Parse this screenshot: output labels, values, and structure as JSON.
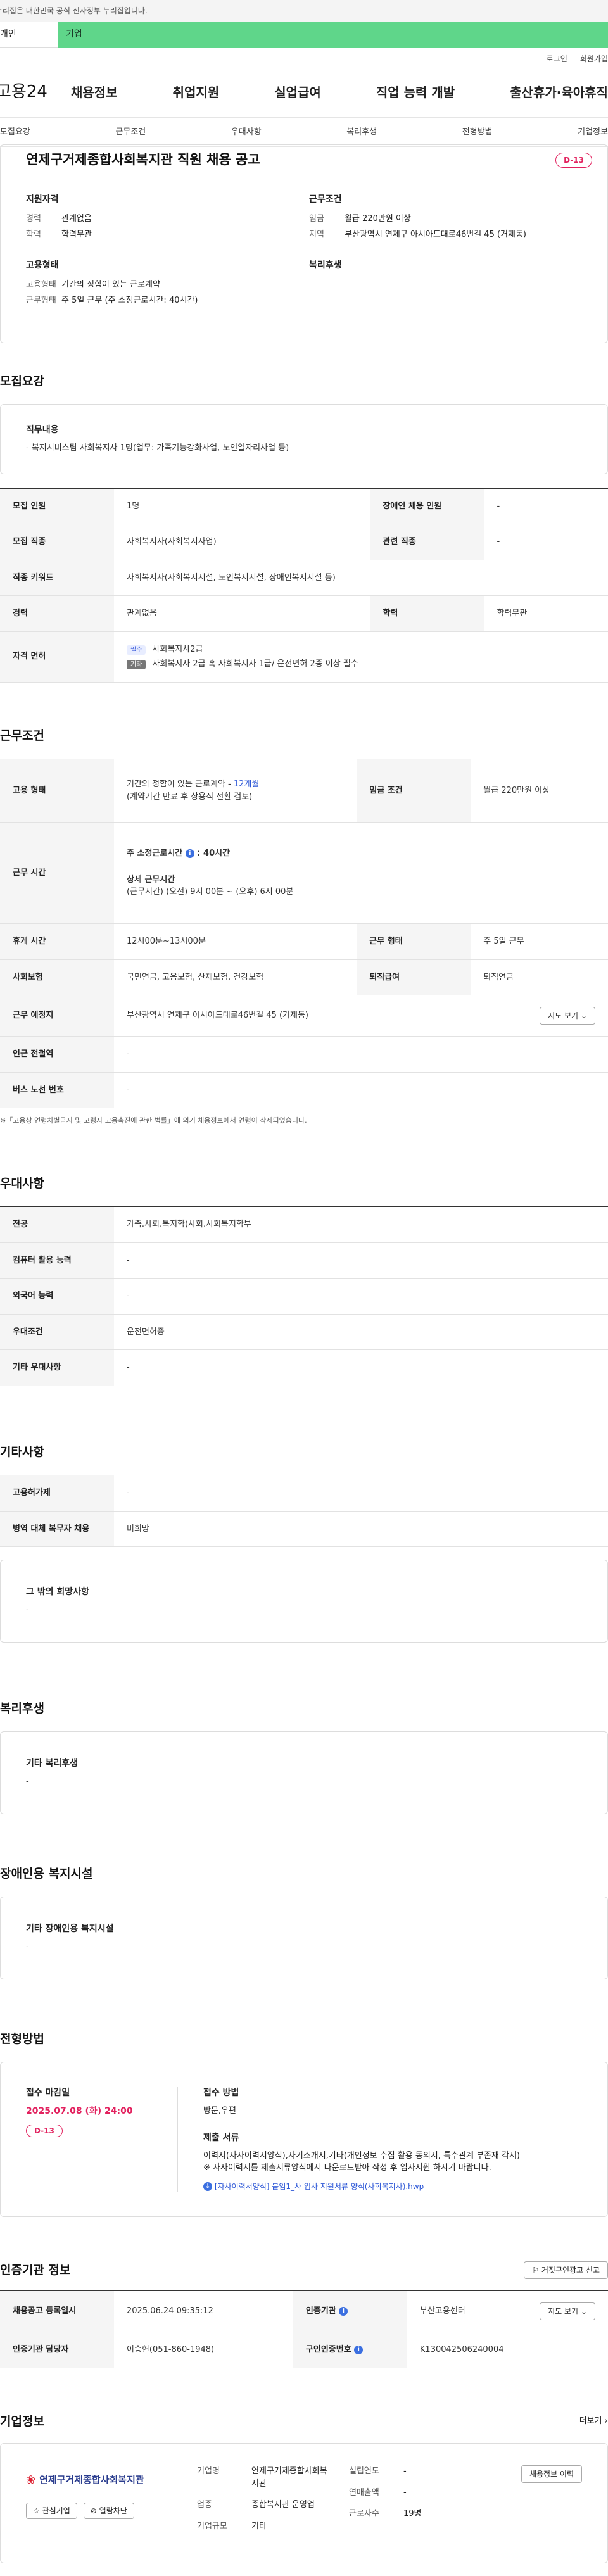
{
  "top_notice": "이 누리집은 대한민국 공식 전자정부 누리집입니다.",
  "site_tabs": [
    "개인",
    "기업"
  ],
  "util_links": [
    "로그인",
    "회원가입"
  ],
  "logo_text": "고용24",
  "gnb": [
    "채용정보",
    "취업지원",
    "실업급여",
    "직업 능력 개발",
    "출산휴가·육아휴직"
  ],
  "anchor_tabs": [
    "모집요강",
    "근무조건",
    "우대사항",
    "복리후생",
    "전형방법",
    "기업정보"
  ],
  "summary": {
    "title": "연제구거제종합사회복지관 직원 채용 공고",
    "dday": "D-13",
    "qual_title": "지원자격",
    "career_k": "경력",
    "career_v": "관계없음",
    "edu_k": "학력",
    "edu_v": "학력무관",
    "emp_title": "고용형태",
    "emptype_k": "고용형태",
    "emptype_v": "기간의 정함이 있는 근로계약",
    "worktype_k": "근무형태",
    "worktype_v": "주 5일 근무 (주 소정근로시간: 40시간)",
    "cond_title": "근무조건",
    "wage_k": "임금",
    "wage_v": "월급 220만원 이상",
    "area_k": "지역",
    "area_v": "부산광역시 연제구 아시아드대로46번길 45 (거제동)",
    "welfare_title": "복리후생"
  },
  "recruit": {
    "title": "모집요강",
    "duty_title": "직무내용",
    "duty_text": "- 복지서비스팀 사회복지사 1명(업무: 가족기능강화사업, 노인일자리사업 등)",
    "headcount_k": "모집 인원",
    "headcount_v": "1명",
    "disabled_k": "장애인 채용 인원",
    "disabled_v": "-",
    "job_k": "모집 직종",
    "job_v": "사회복지사(사회복지사업)",
    "related_k": "관련 직종",
    "related_v": "-",
    "keyword_k": "직종 키워드",
    "keyword_v": "사회복지사(사회복지시설, 노인복지시설, 장애인복지시설 등)",
    "career_k": "경력",
    "career_v": "관계없음",
    "edu_k": "학력",
    "edu_v": "학력무관",
    "license_k": "자격 면허",
    "req_chip": "필수",
    "req_v": "사회복지사2급",
    "pref_chip": "기타",
    "pref_v": "사회복지사 2급 혹 사회복지사 1급/ 운전면허 2종 이상 필수"
  },
  "conditions": {
    "title": "근무조건",
    "emp_k": "고용 형태",
    "emp_v1": "기간의 정함이 있는 근로계약 - ",
    "emp_v1_hl": "12개월",
    "emp_v2": "(계약기간 만료 후 상용직 전환 검토)",
    "wage_k": "임금 조건",
    "wage_v": "월급 220만원 이상",
    "hours_k": "근무 시간",
    "hours_week": "주 소정근로시간",
    "hours_week_v": "40시간",
    "hours_detail_title": "상세 근무시간",
    "hours_detail": "(근무시간) (오전) 9시 00분 ~ (오후) 6시 00분",
    "break_k": "휴게 시간",
    "break_v": "12시00분~13시00분",
    "form_k": "근무 형태",
    "form_v": "주 5일 근무",
    "ins_k": "사회보험",
    "ins_v": "국민연금, 고용보험, 산재보험, 건강보험",
    "severance_k": "퇴직급여",
    "severance_v": "퇴직연금",
    "place_k": "근무 예정지",
    "place_v": "부산광역시 연제구 아시아드대로46번길 45 (거제동)",
    "map_btn": "지도 보기",
    "station_k": "인근 전철역",
    "station_v": "-",
    "bus_k": "버스 노선 번호",
    "bus_v": "-",
    "note": "※「고용상 연령차별금지 및 고령자 고용촉진에 관한 법률」에 의거 채용정보에서 연령이 삭제되었습니다."
  },
  "pref": {
    "title": "우대사항",
    "major_k": "전공",
    "major_v": "가족.사회.복지학(사회.사회복지학부",
    "computer_k": "컴퓨터 활용 능력",
    "computer_v": "-",
    "lang_k": "외국어 능력",
    "lang_v": "-",
    "cond_k": "우대조건",
    "cond_v": "운전면허증",
    "etc_k": "기타 우대사항",
    "etc_v": "-"
  },
  "etc": {
    "title": "기타사항",
    "insured_k": "고용허가제",
    "insured_v": "-",
    "military_k": "병역 대체 복무자 채용",
    "military_v": "비희망",
    "other_title": "그 밖의 희망사항",
    "other_v": "-"
  },
  "welfare": {
    "title": "복리후생",
    "box_title": "기타 복리후생",
    "box_v": "-"
  },
  "disabled_fac": {
    "title": "장애인용 복지시설",
    "box_title": "기타 장애인용 복지시설",
    "box_v": "-"
  },
  "process": {
    "title": "전형방법",
    "deadline_title": "접수 마감일",
    "deadline_v": "2025.07.08 (화) 24:00",
    "dday": "D-13",
    "method_title": "접수 방법",
    "method_v": "방문,우편",
    "docs_title": "제출 서류",
    "docs_v1": "이력서(자사이력서양식),자기소개서,기타(개인정보 수집 활용 동의서, 특수관계 부존재 각서)",
    "docs_v2": "※ 자사이력서를 제출서류양식에서 다운로드받아 작성 후 입사지원 하시기 바랍니다.",
    "file": "[자사이력서양식] 붙임1_사 입사 지원서류 양식(사회복지사).hwp"
  },
  "cert": {
    "title": "인증기관 정보",
    "report_btn": "거짓구인광고 신고",
    "reg_k": "채용공고 등록일시",
    "reg_v": "2025.06.24 09:35:12",
    "org_k": "인증기관",
    "org_v": "부산고용센터",
    "map_btn": "지도 보기",
    "mgr_k": "인증기관 담당자",
    "mgr_v": "이승현(051-860-1948)",
    "no_k": "구인인증번호",
    "no_v": "K130042506240004"
  },
  "company": {
    "title": "기업정보",
    "more": "더보기",
    "logo_name": "연제구거제종합사회복지관",
    "interest_btn": "관심기업",
    "block_btn": "열람차단",
    "name_k": "기업명",
    "name_v": "연제구거제종합사회복지관",
    "industry_k": "업종",
    "industry_v": "종합복지관 운영업",
    "size_k": "기업규모",
    "size_v": "기타",
    "year_k": "설립연도",
    "year_v": "-",
    "sales_k": "연매출액",
    "sales_v": "-",
    "emp_k": "근로자수",
    "emp_v": "19명",
    "history_btn": "채용정보 이력"
  }
}
